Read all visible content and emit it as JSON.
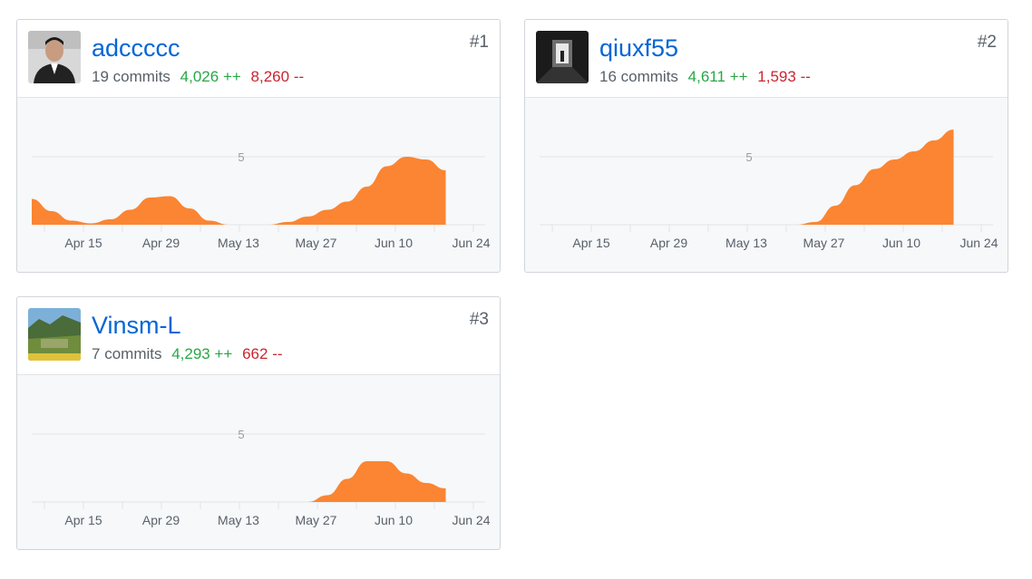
{
  "stats_suffix": {
    "commits": "commits",
    "additions": "++",
    "deletions": "--"
  },
  "contributors": [
    {
      "name": "adccccc",
      "commits": "19",
      "additions": "4,026",
      "deletions": "8,260",
      "rank": "#1",
      "avatar": "user-portrait"
    },
    {
      "name": "qiuxf55",
      "commits": "16",
      "additions": "4,611",
      "deletions": "1,593",
      "rank": "#2",
      "avatar": "tunnel-photo"
    },
    {
      "name": "Vinsm-L",
      "commits": "7",
      "additions": "4,293",
      "deletions": "662",
      "rank": "#3",
      "avatar": "landscape-photo"
    }
  ],
  "chart_data": [
    {
      "type": "area",
      "title": "",
      "series": [
        {
          "values": [
            1.9,
            1.0,
            0.3,
            0.1,
            0.4,
            1.1,
            2.0,
            2.1,
            1.2,
            0.3,
            0,
            0,
            0,
            0.2,
            0.6,
            1.1,
            1.7,
            2.8,
            4.3,
            5.0,
            4.8,
            4.0
          ]
        }
      ],
      "x_ticks": [
        "Apr 15",
        "Apr 29",
        "May 13",
        "May 27",
        "Jun 10",
        "Jun 24"
      ],
      "y_ticks": [
        "5"
      ],
      "ylim": [
        0,
        5
      ],
      "color": "#fb8532",
      "grid": true
    },
    {
      "type": "area",
      "title": "",
      "series": [
        {
          "values": [
            0,
            0,
            0,
            0,
            0,
            0,
            0,
            0,
            0,
            0,
            0,
            0,
            0,
            0,
            0.2,
            1.4,
            2.9,
            4.1,
            4.8,
            5.4,
            6.2,
            7.0
          ]
        }
      ],
      "x_ticks": [
        "Apr 15",
        "Apr 29",
        "May 13",
        "May 27",
        "Jun 10",
        "Jun 24"
      ],
      "y_ticks": [
        "5"
      ],
      "ylim": [
        0,
        5
      ],
      "color": "#fb8532",
      "grid": true
    },
    {
      "type": "area",
      "title": "",
      "series": [
        {
          "values": [
            0,
            0,
            0,
            0,
            0,
            0,
            0,
            0,
            0,
            0,
            0,
            0,
            0,
            0,
            0,
            0.5,
            1.7,
            3.0,
            3.0,
            2.1,
            1.4,
            1.0
          ]
        }
      ],
      "x_ticks": [
        "Apr 15",
        "Apr 29",
        "May 13",
        "May 27",
        "Jun 10",
        "Jun 24"
      ],
      "y_ticks": [
        "5"
      ],
      "ylim": [
        0,
        5
      ],
      "color": "#fb8532",
      "grid": true
    }
  ]
}
